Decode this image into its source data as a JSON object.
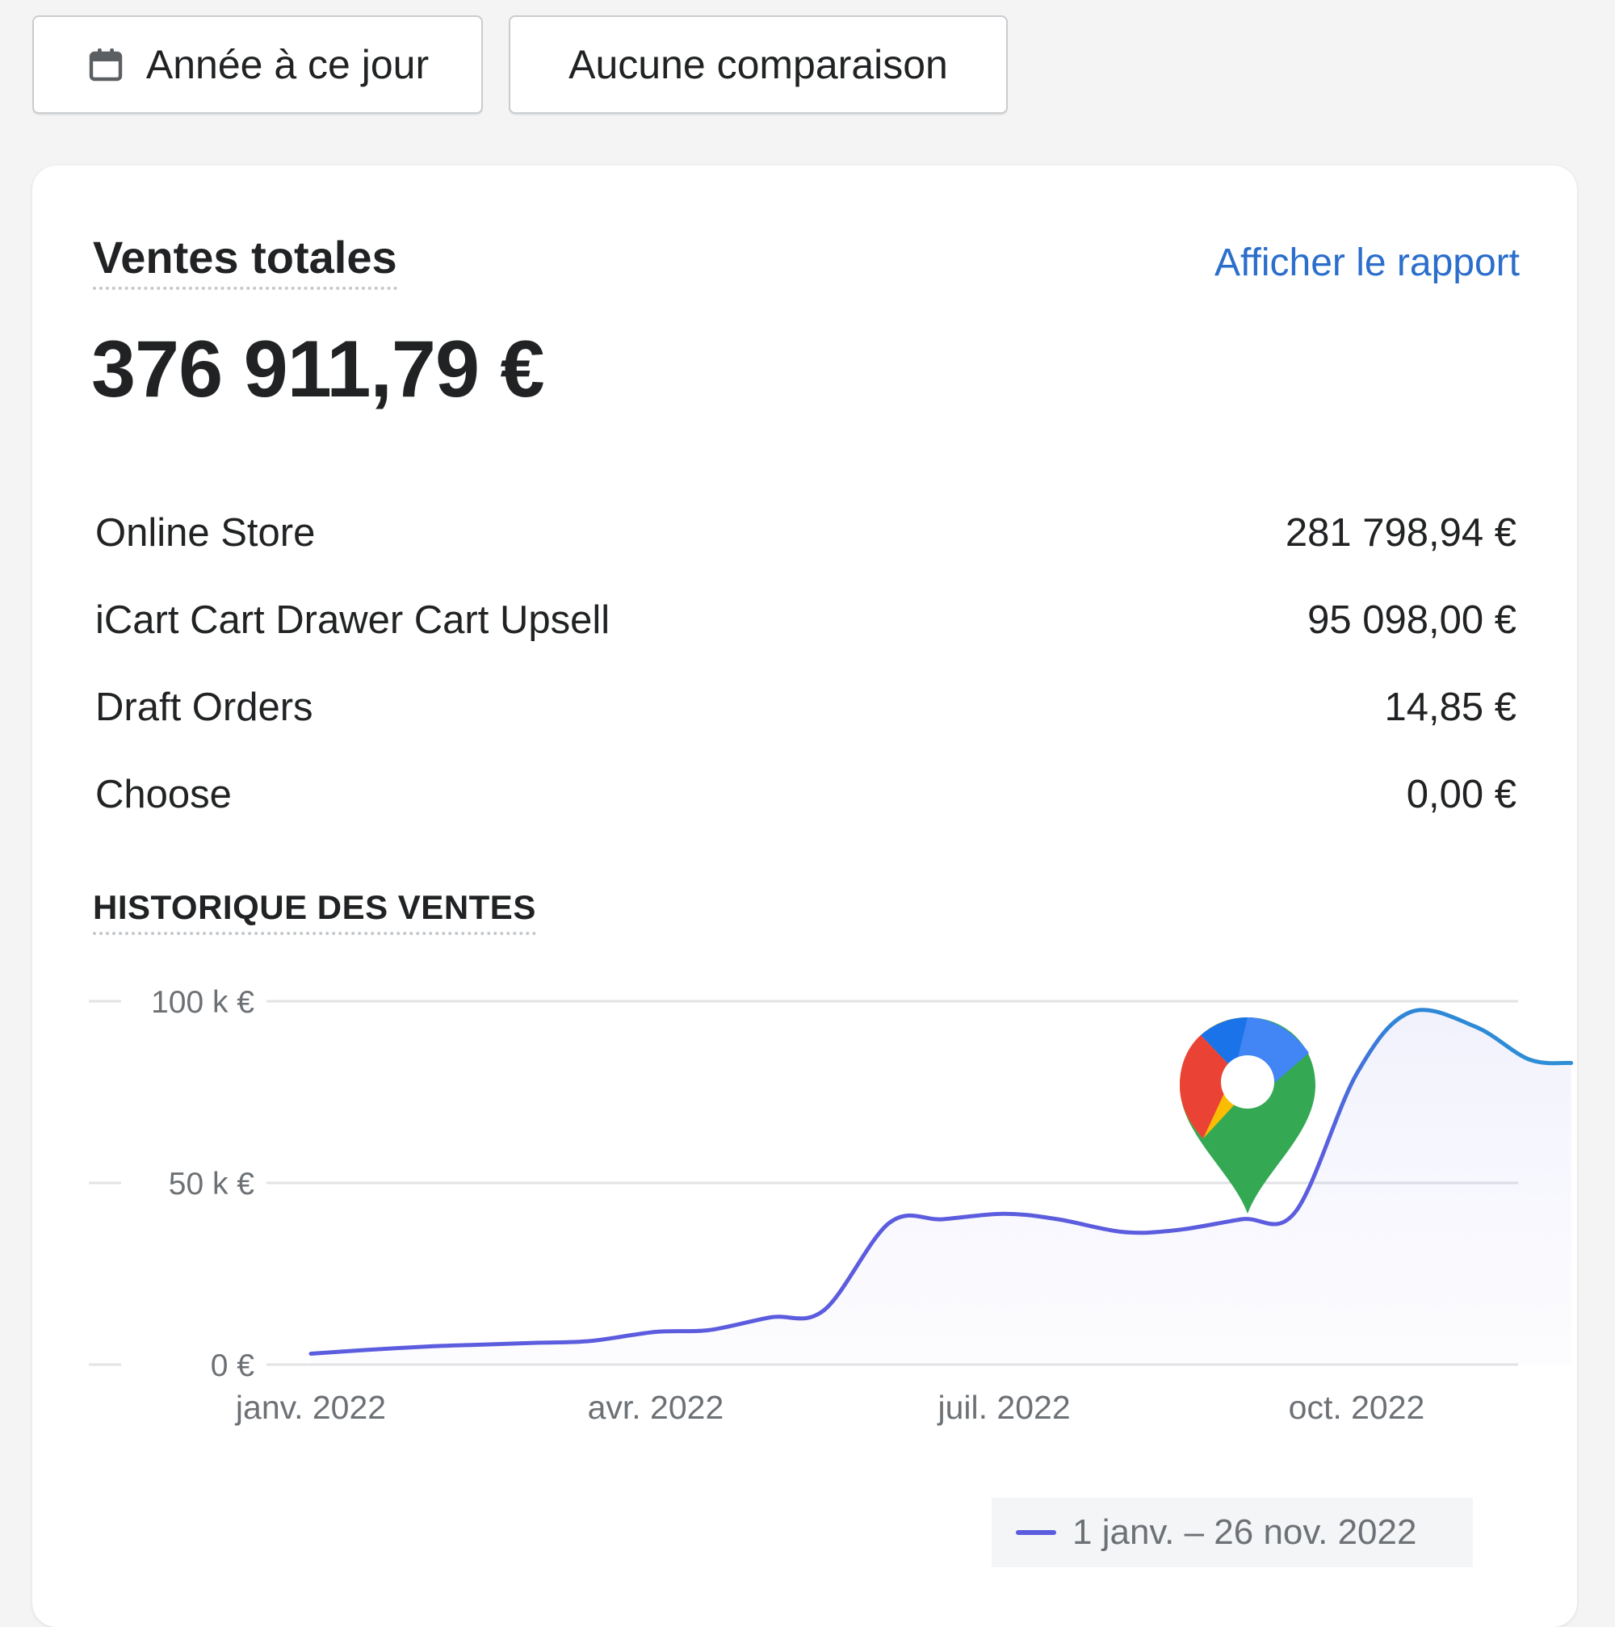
{
  "toolbar": {
    "date_range_label": "Année à ce jour",
    "comparison_label": "Aucune comparaison",
    "date_icon": "calendar-icon"
  },
  "card": {
    "title": "Ventes totales",
    "report_link": "Afficher le rapport",
    "total": "376 911,79 €",
    "channels": [
      {
        "name": "Online Store",
        "value": "281 798,94 €"
      },
      {
        "name": "iCart Cart Drawer Cart Upsell",
        "value": "95 098,00 €"
      },
      {
        "name": "Draft Orders",
        "value": "14,85 €"
      },
      {
        "name": "Choose",
        "value": "0,00 €"
      }
    ],
    "history_title": "HISTORIQUE DES VENTES",
    "map_pin_icon": "google-maps-pin-icon"
  },
  "chart_data": {
    "type": "line",
    "x_tick_labels": [
      "janv. 2022",
      "avr. 2022",
      "juil. 2022",
      "oct. 2022"
    ],
    "y_tick_labels": [
      "100 k €",
      "50 k €",
      "0 €"
    ],
    "ylim": [
      0,
      100000
    ],
    "series": [
      {
        "name": "1 janv. – 26 nov. 2022",
        "color": "#5c5cdf",
        "x": [
          "2022-01-01",
          "2022-01-15",
          "2022-02-01",
          "2022-02-15",
          "2022-03-01",
          "2022-03-15",
          "2022-04-01",
          "2022-04-15",
          "2022-05-01",
          "2022-05-15",
          "2022-06-01",
          "2022-06-15",
          "2022-07-01",
          "2022-07-15",
          "2022-08-01",
          "2022-08-15",
          "2022-09-01",
          "2022-09-15",
          "2022-10-01",
          "2022-10-15",
          "2022-11-01",
          "2022-11-15",
          "2022-11-26"
        ],
        "values": [
          3000,
          4000,
          5000,
          5500,
          6000,
          6500,
          9000,
          9500,
          13000,
          15000,
          39000,
          40000,
          41500,
          40000,
          36500,
          37000,
          40000,
          42000,
          80000,
          97000,
          93000,
          84000,
          83000
        ]
      }
    ],
    "grid": true,
    "legend": "bottom-right"
  }
}
